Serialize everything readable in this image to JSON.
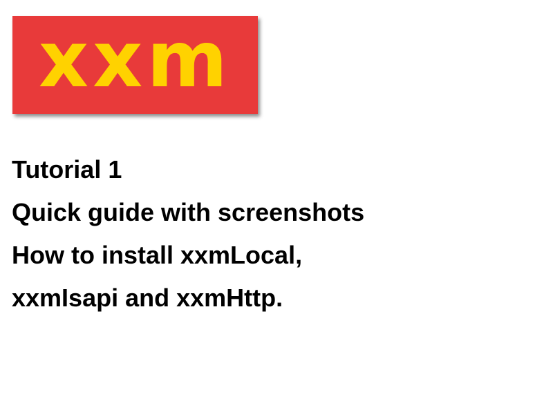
{
  "logo": {
    "text": "xxm",
    "background_color": "#e83a3a",
    "text_color": "#ffd200"
  },
  "title_lines": [
    "Tutorial 1",
    "Quick guide with screenshots",
    "How to install xxmLocal,",
    "xxmIsapi and xxmHttp."
  ]
}
